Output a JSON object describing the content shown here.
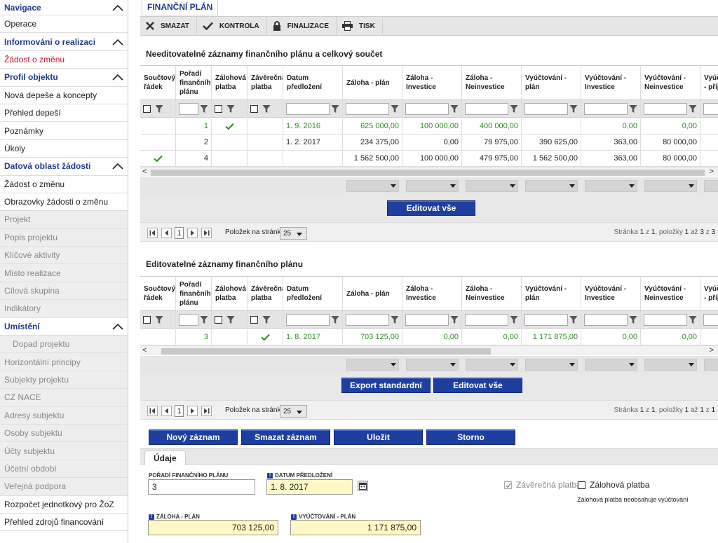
{
  "sidebar": {
    "items": [
      {
        "label": "Navigace",
        "type": "header"
      },
      {
        "label": "Operace",
        "type": "item"
      },
      {
        "label": "Informování o realizaci",
        "type": "header"
      },
      {
        "label": "Žádost o změnu",
        "type": "active"
      },
      {
        "label": "Profil objektu",
        "type": "header"
      },
      {
        "label": "Nová depeše a koncepty",
        "type": "item"
      },
      {
        "label": "Přehled depeší",
        "type": "item"
      },
      {
        "label": "Poznámky",
        "type": "item"
      },
      {
        "label": "Úkoly",
        "type": "item"
      },
      {
        "label": "Datová oblast žádosti",
        "type": "header"
      },
      {
        "label": "Žádost o změnu",
        "type": "item"
      },
      {
        "label": "Obrazovky žádosti o změnu",
        "type": "item"
      },
      {
        "label": "Projekt",
        "type": "disabled"
      },
      {
        "label": "Popis projektu",
        "type": "disabled"
      },
      {
        "label": "Klíčové aktivity",
        "type": "disabled"
      },
      {
        "label": "Místo realizace",
        "type": "disabled"
      },
      {
        "label": "Cílová skupina",
        "type": "disabled"
      },
      {
        "label": "Indikátory",
        "type": "disabled"
      },
      {
        "label": "Umístění",
        "type": "header"
      },
      {
        "label": "Dopad projektu",
        "type": "disabled-indent"
      },
      {
        "label": "Horizontální principy",
        "type": "disabled"
      },
      {
        "label": "Subjekty projektu",
        "type": "disabled"
      },
      {
        "label": "CZ NACE",
        "type": "disabled"
      },
      {
        "label": "Adresy subjektu",
        "type": "disabled"
      },
      {
        "label": "Osoby subjektu",
        "type": "disabled"
      },
      {
        "label": "Účty subjektu",
        "type": "disabled"
      },
      {
        "label": "Účetní období",
        "type": "disabled"
      },
      {
        "label": "Veřejná podpora",
        "type": "disabled"
      },
      {
        "label": "Rozpočet jednotkový pro ŽoZ",
        "type": "item"
      },
      {
        "label": "Přehled zdrojů financování",
        "type": "item"
      }
    ]
  },
  "page": {
    "title": "FINANČNÍ PLÁN"
  },
  "toolbar": {
    "delete": "SMAZAT",
    "check": "KONTROLA",
    "finalize": "FINALIZACE",
    "print": "TISK"
  },
  "columns": [
    {
      "label": "Součtový řádek",
      "width": 51
    },
    {
      "label": "Pořadí finančního plánu",
      "width": 51
    },
    {
      "label": "Zálohová platba",
      "width": 51
    },
    {
      "label": "Závěrečná platba",
      "width": 51
    },
    {
      "label": "Datum předložení",
      "width": 85
    },
    {
      "label": "Záloha - plán",
      "width": 85
    },
    {
      "label": "Záloha - Investice",
      "width": 85
    },
    {
      "label": "Záloha - Neinvestice",
      "width": 85
    },
    {
      "label": "Vyúčtování - plán",
      "width": 85
    },
    {
      "label": "Vyúčtování - Investice",
      "width": 85
    },
    {
      "label": "Vyúčtování - Neinvestice",
      "width": 85
    },
    {
      "label": "Vyúčtování - příjmy",
      "width": 70
    }
  ],
  "grid1": {
    "title": "Needitovatelné záznamy finančního plánu a celkový součet",
    "rows": [
      {
        "sum": false,
        "order": "1",
        "advance": true,
        "final": false,
        "date": "1. 9. 2016",
        "adv_plan": "625 000,00",
        "adv_inv": "100 000,00",
        "adv_noninv": "400 000,00",
        "set_plan": "",
        "set_inv": "0,00",
        "set_noninv": "0,00",
        "set_inc": "",
        "green": true
      },
      {
        "sum": false,
        "order": "2",
        "advance": false,
        "final": false,
        "date": "1. 2. 2017",
        "adv_plan": "234 375,00",
        "adv_inv": "0,00",
        "adv_noninv": "79 975,00",
        "set_plan": "390 625,00",
        "set_inv": "363,00",
        "set_noninv": "80 000,00",
        "set_inc": "",
        "green": false
      },
      {
        "sum": true,
        "order": "4",
        "advance": false,
        "final": false,
        "date": "",
        "adv_plan": "1 562 500,00",
        "adv_inv": "100 000,00",
        "adv_noninv": "479 975,00",
        "set_plan": "1 562 500,00",
        "set_inv": "363,00",
        "set_noninv": "80 000,00",
        "set_inc": "",
        "green": false
      }
    ],
    "edit_all": "Editovat vše",
    "pager": {
      "page": "1",
      "per_page_label": "Položek na stránku",
      "per_page": "25",
      "info_prefix": "Stránka ",
      "page_no": "1",
      "of": " z ",
      "pages": "1",
      "items_label": ", položky ",
      "from": "1",
      "to_label": " až ",
      "to": "3",
      "of2": " z ",
      "total": "3"
    }
  },
  "grid2": {
    "title": "Editovatelné záznamy finančního plánu",
    "rows": [
      {
        "sum": false,
        "order": "3",
        "advance": false,
        "final": true,
        "date": "1. 8. 2017",
        "adv_plan": "703 125,00",
        "adv_inv": "0,00",
        "adv_noninv": "0,00",
        "set_plan": "1 171 875,00",
        "set_inv": "0,00",
        "set_noninv": "0,00",
        "set_inc": "",
        "green": true
      }
    ],
    "export": "Export standardní",
    "edit_all": "Editovat vše",
    "pager": {
      "page": "1",
      "per_page_label": "Položek na stránku",
      "per_page": "25",
      "info_prefix": "Stránka ",
      "page_no": "1",
      "of": " z ",
      "pages": "1",
      "items_label": ", položky ",
      "from": "1",
      "to_label": " až ",
      "to": "1",
      "of2": " z ",
      "total": "1"
    }
  },
  "actions": {
    "new": "Nový záznam",
    "delete": "Smazat záznam",
    "save": "Uložit",
    "cancel": "Storno"
  },
  "detail": {
    "tab": "Údaje",
    "order_label": "POŘADÍ FINANČNÍHO PLÁNU",
    "order_value": "3",
    "date_label": "DATUM PŘEDLOŽENÍ",
    "date_value": "1. 8. 2017",
    "final_label": "Závěrečná platba",
    "advance_label": "Zálohová platba",
    "note": "Zálohová platba neobsahuje vyúčtování",
    "adv_plan_label": "ZÁLOHA - PLÁN",
    "adv_plan_value": "703 125,00",
    "set_plan_label": "VYÚČTOVÁNÍ - PLÁN",
    "set_plan_value": "1 171 875,00",
    "req_mark": "!"
  },
  "colors": {
    "brand": "#1e3a8a",
    "button": "#1f3f9f",
    "green": "#2e8b22",
    "active": "#c8102e",
    "required_bg": "#fff7c4"
  }
}
